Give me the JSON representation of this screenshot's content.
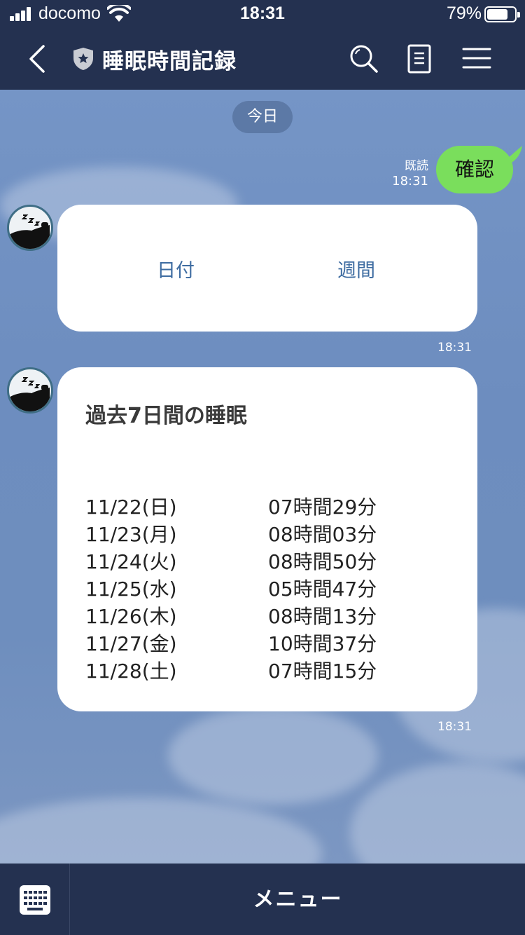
{
  "status_bar": {
    "carrier": "docomo",
    "time": "18:31",
    "battery": "79%",
    "battery_level": 0.79
  },
  "header": {
    "title": "睡眠時間記録",
    "icons": [
      "chevron-left-icon",
      "official-shield-icon",
      "search-icon",
      "notes-icon",
      "hamburger-menu-icon"
    ]
  },
  "chat": {
    "date_separator": "今日",
    "outgoing": {
      "text": "確認",
      "read_label": "既読",
      "time": "18:31"
    },
    "options_card": {
      "options": [
        "日付",
        "週間"
      ],
      "time": "18:31"
    },
    "summary_card": {
      "title": "過去7日間の睡眠",
      "time": "18:31",
      "rows": [
        {
          "date": "11/22(日)",
          "duration": "07時間29分"
        },
        {
          "date": "11/23(月)",
          "duration": "08時間03分"
        },
        {
          "date": "11/24(火)",
          "duration": "08時間50分"
        },
        {
          "date": "11/25(水)",
          "duration": "05時間47分"
        },
        {
          "date": "11/26(木)",
          "duration": "08時間13分"
        },
        {
          "date": "11/27(金)",
          "duration": "10時間37分"
        },
        {
          "date": "11/28(土)",
          "duration": "07時間15分"
        }
      ]
    }
  },
  "bottom_bar": {
    "menu_label": "メニュー"
  },
  "colors": {
    "header_bg": "#243150",
    "chat_bg": "#6e8fbd",
    "my_bubble": "#7ade5c",
    "option_link": "#3e6ca1"
  }
}
